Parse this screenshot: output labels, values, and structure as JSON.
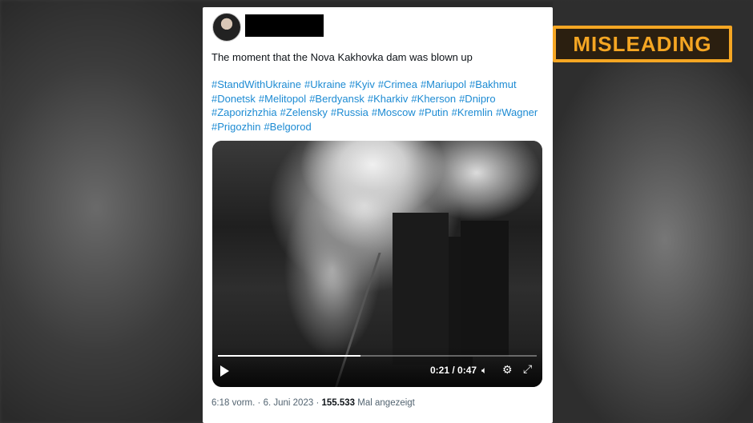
{
  "tweet": {
    "title": "The moment that the Nova Kakhovka dam was blown up",
    "hashtags": [
      "#StandWithUkraine",
      "#Ukraine",
      "#Kyiv",
      "#Crimea",
      "#Mariupol",
      "#Bakhmut",
      "#Donetsk",
      "#Melitopol",
      "#Berdyansk",
      "#Kharkiv",
      "#Kherson",
      "#Dnipro",
      "#Zaporizhzhia",
      "#Zelensky",
      "#Russia",
      "#Moscow",
      "#Putin",
      "#Kremlin",
      "#Wagner",
      "#Prigozhin",
      "#Belgorod"
    ],
    "time": "6:18 vorm.",
    "separator": "·",
    "date": "6. Juni 2023",
    "views_count": "155.533",
    "views_label": "Mal angezeigt"
  },
  "video": {
    "current_time": "0:21",
    "duration": "0:47",
    "time_display": "0:21 / 0:47",
    "progress": 0.447
  },
  "badge": {
    "label": "MISLEADING",
    "color": "#f5a623"
  }
}
